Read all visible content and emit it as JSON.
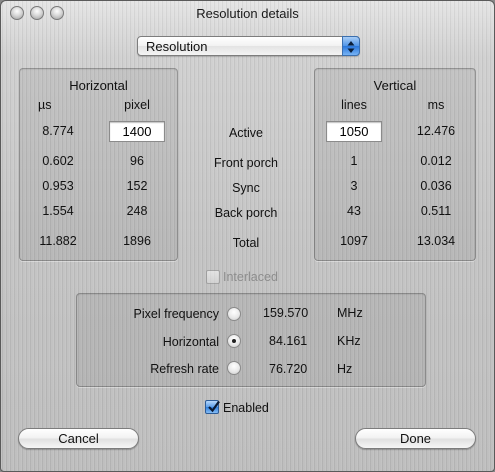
{
  "window": {
    "title": "Resolution details"
  },
  "popup": {
    "selected": "Resolution",
    "icon": "updown-arrows-icon"
  },
  "horizontal": {
    "title": "Horizontal",
    "col_us": "µs",
    "col_pixel": "pixel",
    "active_us": "8.774",
    "active_pixel": "1400",
    "front_us": "0.602",
    "front_pixel": "96",
    "sync_us": "0.953",
    "sync_pixel": "152",
    "back_us": "1.554",
    "back_pixel": "248",
    "total_us": "11.882",
    "total_pixel": "1896"
  },
  "rows": {
    "active": "Active",
    "front_porch": "Front porch",
    "sync": "Sync",
    "back_porch": "Back porch",
    "total": "Total"
  },
  "vertical": {
    "title": "Vertical",
    "col_lines": "lines",
    "col_ms": "ms",
    "active_lines": "1050",
    "active_ms": "12.476",
    "front_lines": "1",
    "front_ms": "0.012",
    "sync_lines": "3",
    "sync_ms": "0.036",
    "back_lines": "43",
    "back_ms": "0.511",
    "total_lines": "1097",
    "total_ms": "13.034"
  },
  "interlaced": {
    "label": "Interlaced",
    "checked": false,
    "enabled": false
  },
  "frequency": {
    "pixel_label": "Pixel frequency",
    "pixel_value": "159.570",
    "pixel_unit": "MHz",
    "horizontal_label": "Horizontal",
    "horizontal_value": "84.161",
    "horizontal_unit": "KHz",
    "refresh_label": "Refresh rate",
    "refresh_value": "76.720",
    "refresh_unit": "Hz",
    "selected": "horizontal"
  },
  "enabled": {
    "label": "Enabled",
    "checked": true
  },
  "buttons": {
    "cancel": "Cancel",
    "done": "Done"
  }
}
